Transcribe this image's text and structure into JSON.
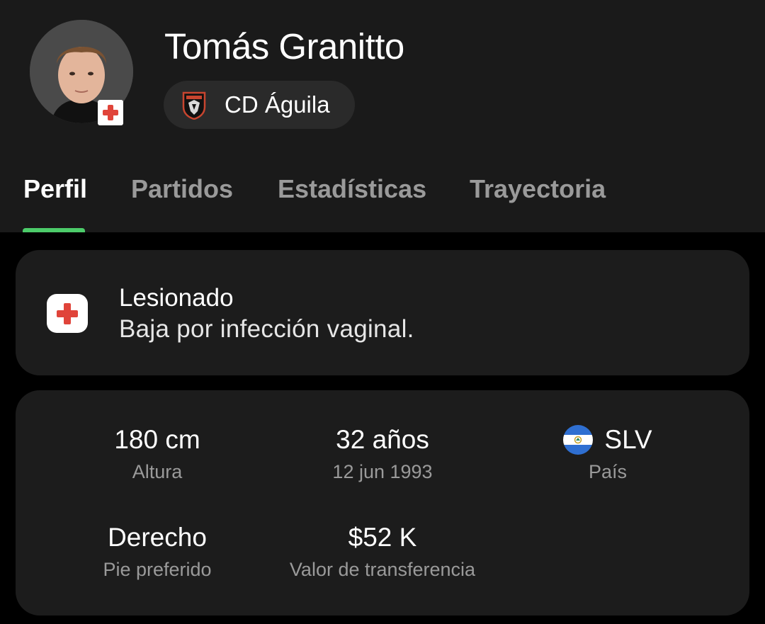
{
  "player": {
    "name": "Tomás Granitto",
    "team": "CD Águila"
  },
  "tabs": [
    {
      "label": "Perfil",
      "active": true
    },
    {
      "label": "Partidos",
      "active": false
    },
    {
      "label": "Estadísticas",
      "active": false
    },
    {
      "label": "Trayectoria",
      "active": false
    }
  ],
  "injury": {
    "title": "Lesionado",
    "description": "Baja por infección vaginal."
  },
  "stats": {
    "height": {
      "value": "180 cm",
      "label": "Altura"
    },
    "age": {
      "value": "32 años",
      "label": "12 jun 1993"
    },
    "country": {
      "value": "SLV",
      "label": "País",
      "flag_icon": "el-salvador-flag-icon"
    },
    "foot": {
      "value": "Derecho",
      "label": "Pie preferido"
    },
    "market_value": {
      "value": "$52 K",
      "label": "Valor de transferencia"
    }
  },
  "colors": {
    "accent": "#4ccc6a",
    "injury": "#e0443a",
    "background": "#000000",
    "surface": "#1c1c1c",
    "header": "#1a1a1a",
    "muted_text": "#9a9a9a"
  }
}
